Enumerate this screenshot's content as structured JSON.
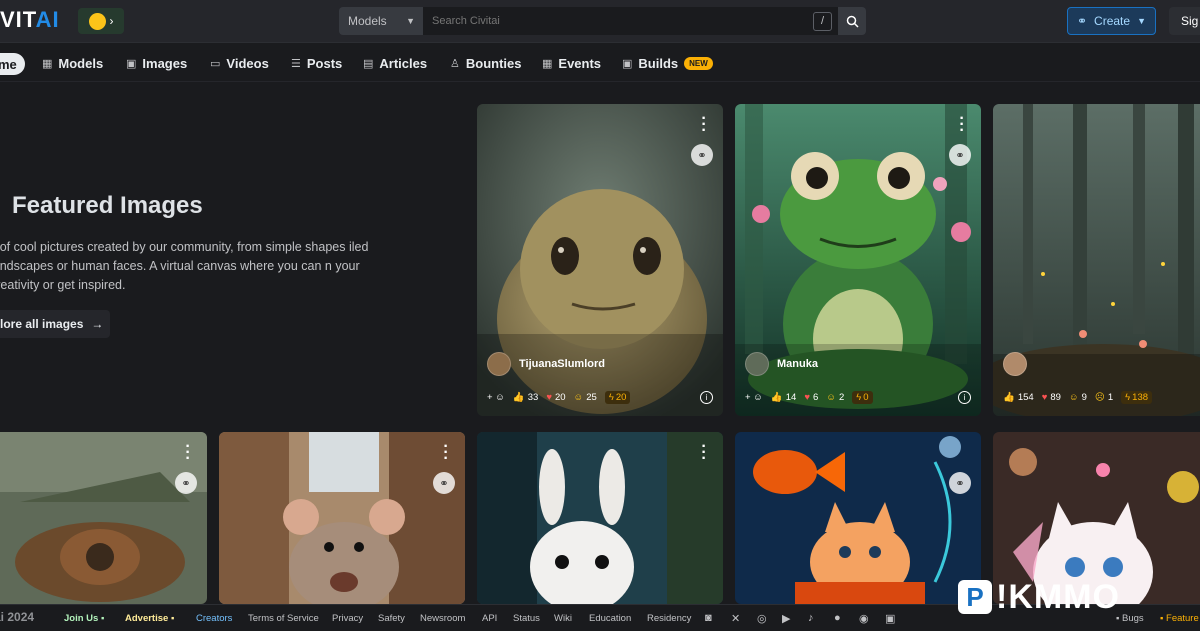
{
  "header": {
    "logo_left": "VIT",
    "logo_right": "AI",
    "search_type": "Models",
    "search_placeholder": "Search Civitai",
    "search_shortcut": "/",
    "create_label": "Create",
    "signin_label": "Sig"
  },
  "nav": {
    "items": [
      {
        "label": "me",
        "icon": "home-icon"
      },
      {
        "label": "Models",
        "icon": "grid-icon"
      },
      {
        "label": "Images",
        "icon": "image-icon"
      },
      {
        "label": "Videos",
        "icon": "video-icon"
      },
      {
        "label": "Posts",
        "icon": "posts-icon"
      },
      {
        "label": "Articles",
        "icon": "article-icon"
      },
      {
        "label": "Bounties",
        "icon": "bounty-icon"
      },
      {
        "label": "Events",
        "icon": "calendar-icon"
      },
      {
        "label": "Builds",
        "icon": "builds-icon"
      }
    ],
    "builds_badge": "NEW"
  },
  "hero": {
    "title": "Featured Images",
    "description": "s of cool pictures created by our community, from simple shapes iled landscapes or human faces. A virtual canvas where you can n your creativity or get inspired.",
    "explore_label": "lore all images"
  },
  "cards": [
    {
      "author": "TijuanaSlumlord",
      "likes": "33",
      "hearts": "20",
      "laughs": "25",
      "buzz": "20"
    },
    {
      "author": "Manuka",
      "likes": "14",
      "hearts": "6",
      "laughs": "2",
      "buzz": "0"
    },
    {
      "author": "",
      "likes": "154",
      "hearts": "89",
      "laughs": "9",
      "cry": "1",
      "buzz": "138"
    }
  ],
  "footer": {
    "copyright": "ai 2024",
    "join": "Join Us",
    "advertise": "Advertise",
    "creators": "Creators",
    "links": [
      "Terms of Service",
      "Privacy",
      "Safety",
      "Newsroom",
      "API",
      "Status",
      "Wiki",
      "Education",
      "Residency"
    ],
    "bugs": "Bugs",
    "feature": "Feature"
  },
  "watermark": "P!KMMO",
  "colors": {
    "accent": "#228be6",
    "buzz": "#fab005",
    "background": "#1a1b1e"
  }
}
